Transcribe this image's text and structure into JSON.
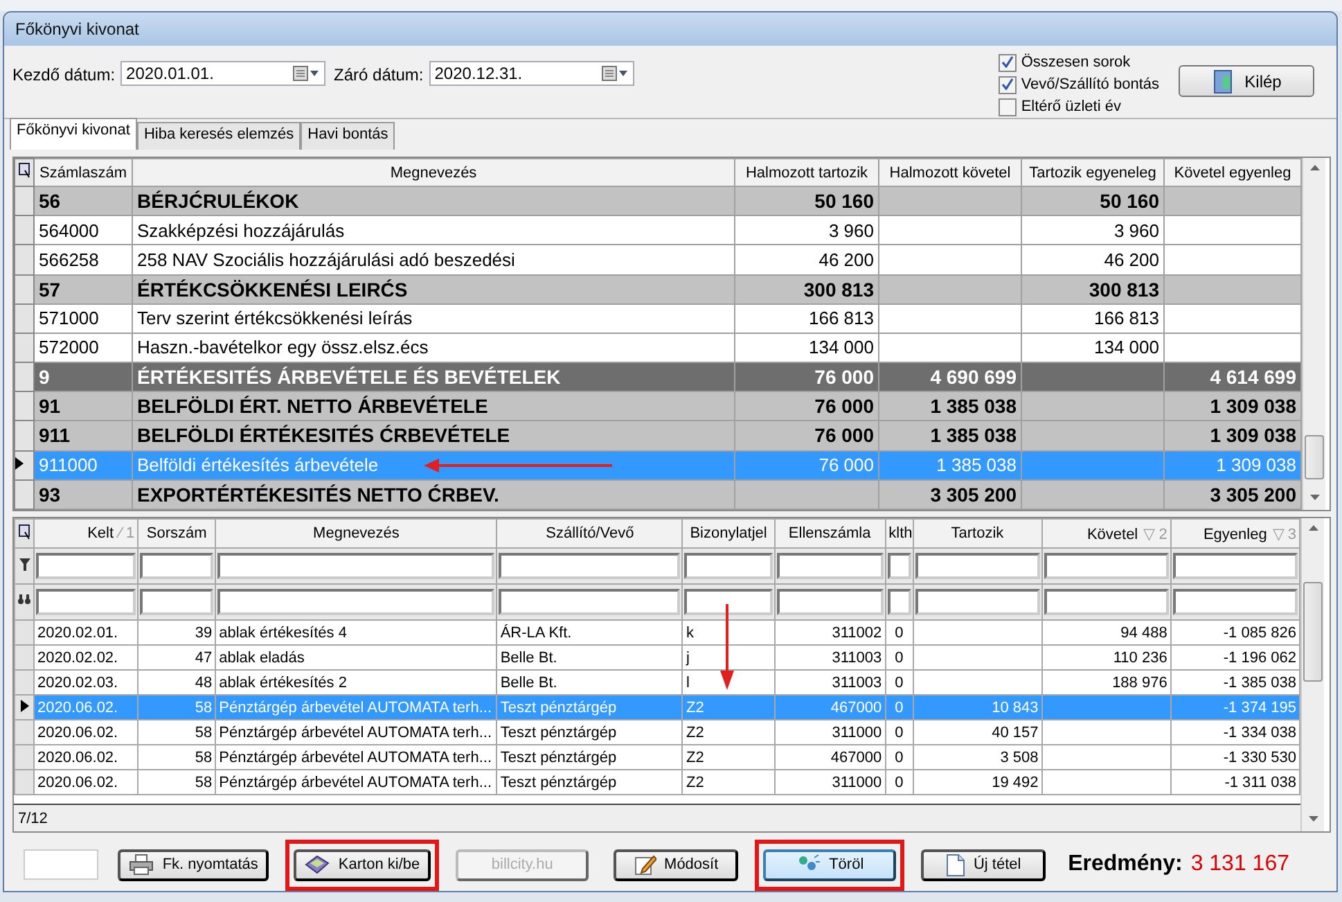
{
  "window": {
    "title": "Főkönyvi kivonat"
  },
  "filters": {
    "start_label": "Kezdő dátum:",
    "start_value": "2020.01.01.",
    "end_label": "Záró dátum:",
    "end_value": "2020.12.31."
  },
  "options": [
    {
      "label": "Összesen sorok",
      "checked": true
    },
    {
      "label": "Vevő/Szállító bontás",
      "checked": true
    },
    {
      "label": "Eltérő üzleti év",
      "checked": false
    }
  ],
  "exit_button": "Kilép",
  "tabs": [
    {
      "label": "Főkönyvi kivonat",
      "selected": true
    },
    {
      "label": "Hiba keresés elemzés",
      "selected": false
    },
    {
      "label": "Havi bontás",
      "selected": false
    }
  ],
  "accounts": {
    "columns": [
      "Számlaszám",
      "Megnevezés",
      "Halmozott tartozik",
      "Halmozott követel",
      "Tartozik egyeneleg",
      "Követel egyenleg"
    ],
    "rows": [
      {
        "kind": "group",
        "selected": false,
        "marked": false,
        "cells": [
          "56",
          "BÉRJĆRULÉKOK",
          "50 160",
          "",
          "50 160",
          ""
        ]
      },
      {
        "kind": "account",
        "selected": false,
        "marked": false,
        "cells": [
          "564000",
          "Szakképzési hozzájárulás",
          "3 960",
          "",
          "3 960",
          ""
        ]
      },
      {
        "kind": "account",
        "selected": false,
        "marked": false,
        "cells": [
          "566258",
          "258 NAV Szociális hozzájárulási adó beszedési",
          "46 200",
          "",
          "46 200",
          ""
        ]
      },
      {
        "kind": "group",
        "selected": false,
        "marked": false,
        "cells": [
          "57",
          "ÉRTÉKCSÖKKENÉSI LEIRĆS",
          "300 813",
          "",
          "300 813",
          ""
        ]
      },
      {
        "kind": "account",
        "selected": false,
        "marked": false,
        "cells": [
          "571000",
          "Terv szerint értékcsökkenési leírás",
          "166 813",
          "",
          "166 813",
          ""
        ]
      },
      {
        "kind": "account",
        "selected": false,
        "marked": false,
        "cells": [
          "572000",
          "Haszn.-bavételkor egy össz.elsz.écs",
          "134 000",
          "",
          "134 000",
          ""
        ]
      },
      {
        "kind": "class",
        "selected": false,
        "marked": false,
        "cells": [
          "9",
          "ÉRTÉKESITÉS ÁRBEVÉTELE ÉS BEVÉTELEK",
          "76 000",
          "4 690 699",
          "",
          "4 614 699"
        ]
      },
      {
        "kind": "group",
        "selected": false,
        "marked": false,
        "cells": [
          "91",
          "BELFÖLDI ÉRT. NETTO ÁRBEVÉTELE",
          "76 000",
          "1 385 038",
          "",
          "1 309 038"
        ]
      },
      {
        "kind": "group",
        "selected": false,
        "marked": false,
        "cells": [
          "911",
          "BELFÖLDI ÉRTÉKESITÉS ĆRBEVÉTELE",
          "76 000",
          "1 385 038",
          "",
          "1 309 038"
        ]
      },
      {
        "kind": "account",
        "selected": true,
        "marked": true,
        "cells": [
          "911000",
          "Belföldi értékesítés árbevétele",
          "76 000",
          "1 385 038",
          "",
          "1 309 038"
        ]
      },
      {
        "kind": "group",
        "selected": false,
        "marked": false,
        "cells": [
          "93",
          "EXPORTÉRTÉKESITÉS NETTO ĆRBEV.",
          "",
          "3 305 200",
          "",
          "3 305 200"
        ]
      }
    ]
  },
  "entries": {
    "columns": [
      {
        "label": "Kelt",
        "sort": "∕ 1"
      },
      {
        "label": "Sorszám"
      },
      {
        "label": "Megnevezés"
      },
      {
        "label": "Szállító/Vevő"
      },
      {
        "label": "Bizonylatjel",
        "marked": true
      },
      {
        "label": "Ellenszámla"
      },
      {
        "label": "klth"
      },
      {
        "label": "Tartozik"
      },
      {
        "label": "Követel",
        "sort": "▽ 2"
      },
      {
        "label": "Egyenleg",
        "sort": "▽ 3"
      }
    ],
    "rows": [
      {
        "selected": false,
        "cells": [
          "2020.02.01.",
          "39",
          "ablak értékesítés 4",
          "ÁR-LA Kft.",
          "k",
          "311002",
          "0",
          "",
          "94 488",
          "-1 085 826"
        ]
      },
      {
        "selected": false,
        "cells": [
          "2020.02.02.",
          "47",
          "ablak eladás",
          "Belle Bt.",
          "j",
          "311003",
          "0",
          "",
          "110 236",
          "-1 196 062"
        ]
      },
      {
        "selected": false,
        "cells": [
          "2020.02.03.",
          "48",
          "ablak értékesítés 2",
          "Belle Bt.",
          "l",
          "311003",
          "0",
          "",
          "188 976",
          "-1 385 038"
        ]
      },
      {
        "selected": true,
        "cells": [
          "2020.06.02.",
          "58",
          "Pénztárgép árbevétel AUTOMATA terh...",
          "Teszt pénztárgép",
          "Z2",
          "467000",
          "0",
          "10 843",
          "",
          "-1 374 195"
        ]
      },
      {
        "selected": false,
        "cells": [
          "2020.06.02.",
          "58",
          "Pénztárgép árbevétel AUTOMATA terh...",
          "Teszt pénztárgép",
          "Z2",
          "311000",
          "0",
          "40 157",
          "",
          "-1 334 038"
        ]
      },
      {
        "selected": false,
        "cells": [
          "2020.06.02.",
          "58",
          "Pénztárgép árbevétel AUTOMATA terh...",
          "Teszt pénztárgép",
          "Z2",
          "467000",
          "0",
          "3 508",
          "",
          "-1 330 530"
        ]
      },
      {
        "selected": false,
        "cells": [
          "2020.06.02.",
          "58",
          "Pénztárgép árbevétel AUTOMATA terh...",
          "Teszt pénztárgép",
          "Z2",
          "311000",
          "0",
          "19 492",
          "",
          "-1 311 038"
        ]
      }
    ],
    "record_count": "7/12"
  },
  "footer": {
    "buttons": [
      {
        "kind": "print",
        "label": "Fk. nyomtatás",
        "highlighted": false,
        "disabled": false
      },
      {
        "kind": "card",
        "label": "Karton ki/be",
        "highlighted": true,
        "disabled": false
      },
      {
        "kind": "plain",
        "label": "billcity.hu",
        "highlighted": false,
        "disabled": true
      },
      {
        "kind": "edit",
        "label": "Módosít",
        "highlighted": false,
        "disabled": false
      },
      {
        "kind": "delete",
        "label": "Töröl",
        "highlighted": true,
        "disabled": false
      },
      {
        "kind": "new",
        "label": "Új tétel",
        "highlighted": false,
        "disabled": false
      }
    ],
    "result_label": "Eredmény:",
    "result_value": "3 131 167"
  }
}
